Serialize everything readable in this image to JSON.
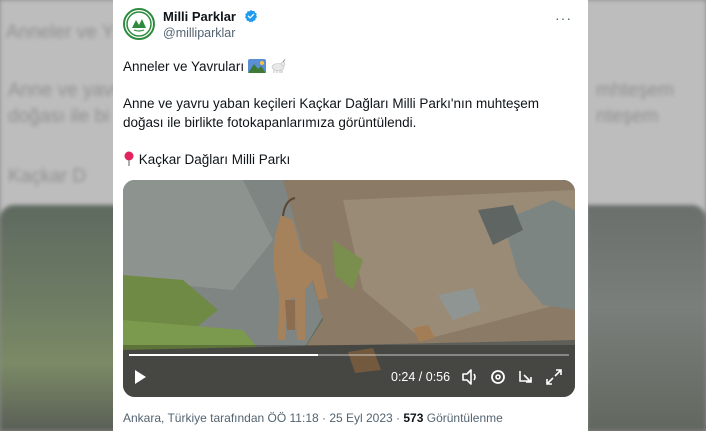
{
  "background": {
    "line1": "Anneler ve Y",
    "line2": "Anne ve yavr",
    "line3": "doğası ile bi",
    "line4": "Kaçkar D",
    "line5": "mhteşem",
    "line6": "nteşem"
  },
  "tweet": {
    "account_name": "Milli Parklar",
    "handle": "@milliparklar",
    "more_icon_label": "···",
    "text_line1": "Anneler ve Yavruları",
    "text_line2": "Anne ve yavru yaban keçileri Kaçkar Dağları Milli Parkı'nın muhteşem",
    "text_line3": "doğası ile birlikte fotokapanlarımıza görüntülendi.",
    "location_text": "Kaçkar Dağları Milli Parkı",
    "video": {
      "time_display": "0:24 / 0:56",
      "progress_fraction": 0.43
    },
    "meta_location_time": "Ankara, Türkiye tarafından ÖÖ 11:18 · 25 Eyl 2023 · ",
    "views_count": "573",
    "views_label": " Görüntülenme"
  },
  "colors": {
    "verified_blue": "#1d9bf0",
    "brand_green": "#2e8b3e",
    "text_primary": "#0f1419",
    "text_secondary": "#536471"
  }
}
